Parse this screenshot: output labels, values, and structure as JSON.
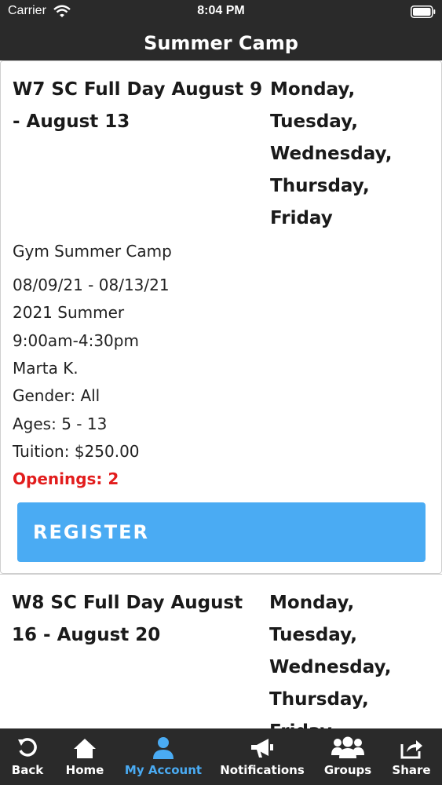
{
  "status_bar": {
    "carrier": "Carrier",
    "time": "8:04 PM"
  },
  "nav": {
    "title": "Summer Camp"
  },
  "classes": [
    {
      "title": "W7 SC Full Day August 9 - August 13",
      "days": [
        "Monday,",
        "Tuesday,",
        "Wednesday,",
        "Thursday,",
        "Friday"
      ],
      "location": "Gym Summer Camp",
      "dates": "08/09/21 - 08/13/21",
      "session": "2021 Summer",
      "time": "9:00am-4:30pm",
      "instructor": "Marta K.",
      "gender": "Gender: All",
      "ages": "Ages: 5 - 13",
      "tuition": "Tuition: $250.00",
      "openings": "Openings: 2",
      "register_label": "REGISTER"
    },
    {
      "title": "W8 SC Full Day August 16 - August 20",
      "days": [
        "Monday,",
        "Tuesday,",
        "Wednesday,",
        "Thursday,",
        "Friday"
      ]
    }
  ],
  "tab_bar": {
    "items": [
      {
        "label": "Back",
        "icon": "back-icon"
      },
      {
        "label": "Home",
        "icon": "home-icon"
      },
      {
        "label": "My Account",
        "icon": "user-icon",
        "active": true
      },
      {
        "label": "Notifications",
        "icon": "megaphone-icon"
      },
      {
        "label": "Groups",
        "icon": "groups-icon"
      },
      {
        "label": "Share",
        "icon": "share-icon"
      }
    ]
  },
  "colors": {
    "accent": "#4aabf3",
    "openings": "#e21d1d",
    "bar": "#2a2a2a"
  }
}
